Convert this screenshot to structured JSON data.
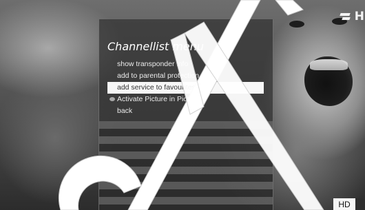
{
  "channel": {
    "logo_text": "H"
  },
  "menu": {
    "title": "Channellist menu",
    "items": [
      {
        "label": "show transponder info",
        "selected": false,
        "bullet": false
      },
      {
        "label": "add to parental protection",
        "selected": false,
        "bullet": false
      },
      {
        "label": "add service to favourites",
        "selected": true,
        "bullet": false
      },
      {
        "label": "Activate Picture in Picture",
        "selected": false,
        "bullet": true
      },
      {
        "label": "back",
        "selected": false,
        "bullet": false
      }
    ]
  },
  "badge": {
    "hd_label": "HD"
  },
  "colors": {
    "highlight": "#f7f7f7",
    "panel": "#323232",
    "text": "#ececec"
  }
}
